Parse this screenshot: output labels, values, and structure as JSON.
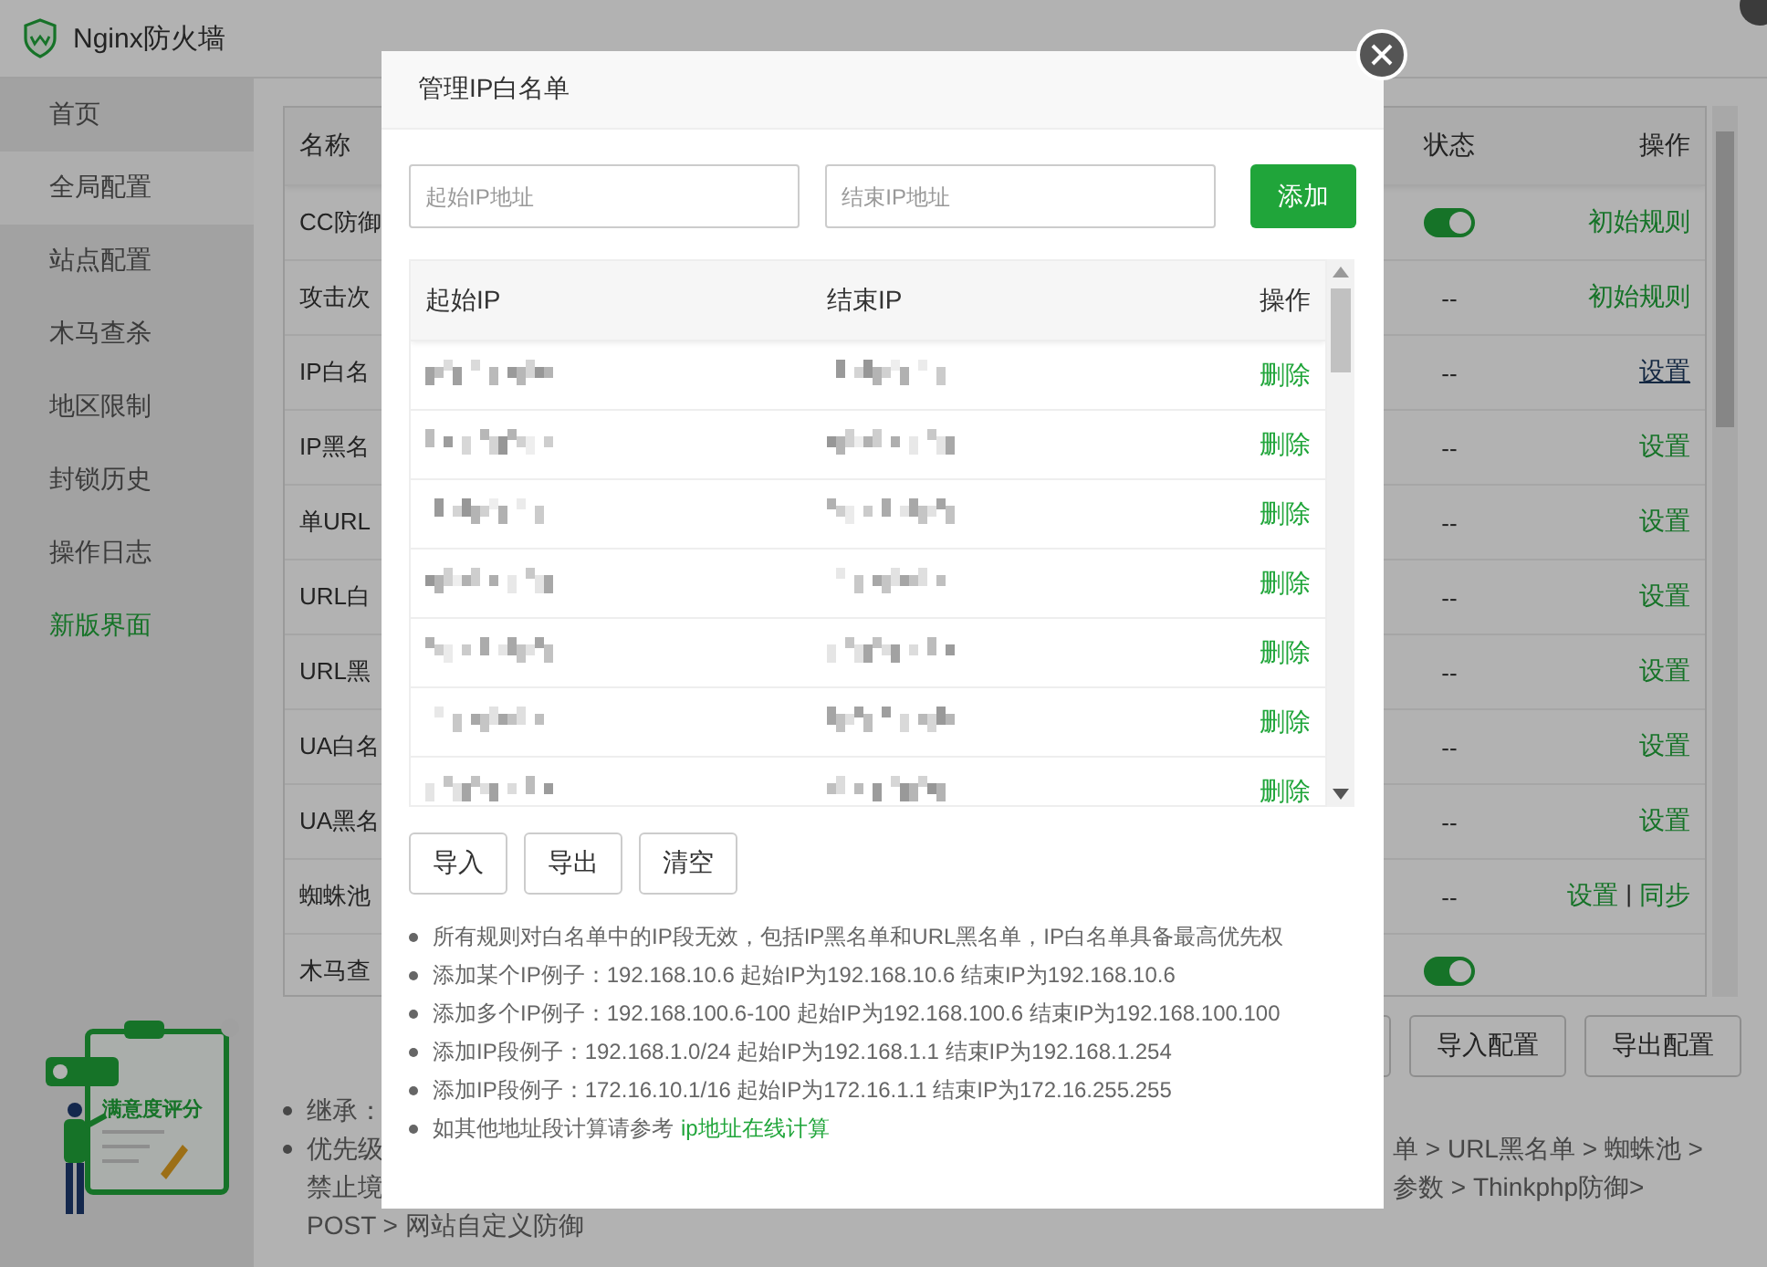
{
  "app": {
    "title": "Nginx防火墙"
  },
  "sidebar": {
    "items": [
      {
        "label": "首页",
        "selected": false,
        "kind": "nav"
      },
      {
        "label": "全局配置",
        "selected": true,
        "kind": "nav"
      },
      {
        "label": "站点配置",
        "selected": false,
        "kind": "nav"
      },
      {
        "label": "木马查杀",
        "selected": false,
        "kind": "nav"
      },
      {
        "label": "地区限制",
        "selected": false,
        "kind": "nav"
      },
      {
        "label": "封锁历史",
        "selected": false,
        "kind": "nav"
      },
      {
        "label": "操作日志",
        "selected": false,
        "kind": "nav"
      },
      {
        "label": "新版界面",
        "selected": false,
        "kind": "accent"
      }
    ]
  },
  "table": {
    "columns": [
      "名称",
      "状态",
      "操作"
    ],
    "rows": [
      {
        "name": "CC防御",
        "status": {
          "kind": "toggle",
          "on": true
        },
        "actions": [
          {
            "label": "初始规则",
            "hovered": false
          }
        ]
      },
      {
        "name": "攻击次",
        "status": {
          "kind": "text",
          "text": "--"
        },
        "actions": [
          {
            "label": "初始规则",
            "hovered": false
          }
        ]
      },
      {
        "name": "IP白名",
        "status": {
          "kind": "text",
          "text": "--"
        },
        "actions": [
          {
            "label": "设置",
            "hovered": true
          }
        ]
      },
      {
        "name": "IP黑名",
        "status": {
          "kind": "text",
          "text": "--"
        },
        "actions": [
          {
            "label": "设置",
            "hovered": false
          }
        ]
      },
      {
        "name": "单URL",
        "status": {
          "kind": "text",
          "text": "--"
        },
        "actions": [
          {
            "label": "设置",
            "hovered": false
          }
        ]
      },
      {
        "name": "URL白",
        "status": {
          "kind": "text",
          "text": "--"
        },
        "actions": [
          {
            "label": "设置",
            "hovered": false
          }
        ]
      },
      {
        "name": "URL黑",
        "status": {
          "kind": "text",
          "text": "--"
        },
        "actions": [
          {
            "label": "设置",
            "hovered": false
          }
        ]
      },
      {
        "name": "UA白名",
        "status": {
          "kind": "text",
          "text": "--"
        },
        "actions": [
          {
            "label": "设置",
            "hovered": false
          }
        ]
      },
      {
        "name": "UA黑名",
        "status": {
          "kind": "text",
          "text": "--"
        },
        "actions": [
          {
            "label": "设置",
            "hovered": false
          }
        ]
      },
      {
        "name": "蜘蛛池",
        "status": {
          "kind": "text",
          "text": "--"
        },
        "actions": [
          {
            "label": "设置",
            "hovered": false
          },
          {
            "label": "同步",
            "hovered": false
          }
        ],
        "separator": "|"
      },
      {
        "name": "木马查",
        "status": {
          "kind": "toggle",
          "on": true
        },
        "actions": []
      }
    ]
  },
  "buttons": [
    "导入配置",
    "导出配置"
  ],
  "notes": [
    {
      "left": "继承：",
      "continuation": false
    },
    {
      "left": "优先级",
      "right": "单 > URL黑名单 > 蜘蛛池 >",
      "continuation": false
    },
    {
      "left": "禁止境",
      "right": "参数 > Thinkphp防御>",
      "continuation": true
    },
    {
      "left": "POST > 网站自定义防御",
      "continuation": true
    }
  ],
  "feedback_widget": {
    "label": "满意度评分"
  },
  "modal": {
    "title": "管理IP白名单",
    "start_placeholder": "起始IP地址",
    "end_placeholder": "结束IP地址",
    "add_button": "添加",
    "columns": [
      "起始IP",
      "结束IP",
      "操作"
    ],
    "rows": [
      {
        "action": "删除"
      },
      {
        "action": "删除"
      },
      {
        "action": "删除"
      },
      {
        "action": "删除"
      },
      {
        "action": "删除"
      },
      {
        "action": "删除"
      },
      {
        "action": "删除"
      }
    ],
    "buttons": [
      "导入",
      "导出",
      "清空"
    ],
    "notes": [
      {
        "text": "所有规则对白名单中的IP段无效，包括IP黑名单和URL黑名单，IP白名单具备最高优先权"
      },
      {
        "text": "添加某个IP例子：192.168.10.6 起始IP为192.168.10.6 结束IP为192.168.10.6"
      },
      {
        "text": "添加多个IP例子：192.168.100.6-100 起始IP为192.168.100.6 结束IP为192.168.100.100"
      },
      {
        "text": "添加IP段例子：192.168.1.0/24 起始IP为192.168.1.1 结束IP为192.168.1.254"
      },
      {
        "text": "添加IP段例子：172.16.10.1/16 起始IP为172.16.1.1 结束IP为172.16.255.255"
      },
      {
        "text": "如其他地址段计算请参考",
        "link": "ip地址在线计算"
      }
    ]
  }
}
